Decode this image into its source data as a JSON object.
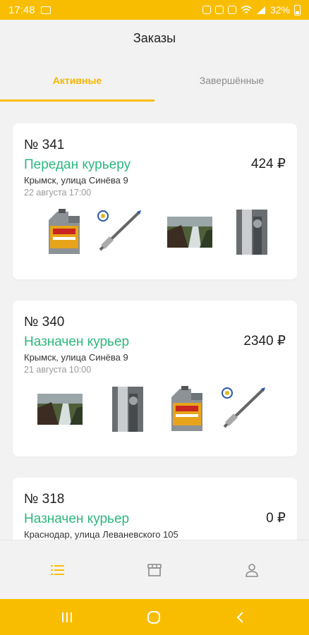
{
  "status_bar": {
    "time": "17:48",
    "battery": "32%",
    "icons": [
      "image-icon",
      "alarm-icon",
      "mute-icon",
      "nfc-icon",
      "wifi-icon",
      "signal-icon",
      "battery-icon"
    ]
  },
  "header": {
    "title": "Заказы"
  },
  "tabs": [
    {
      "label": "Активные",
      "active": true
    },
    {
      "label": "Завершённые",
      "active": false
    }
  ],
  "orders": [
    {
      "number": "№ 341",
      "status": "Передан курьеру",
      "price": "424 ₽",
      "address": "Крымск, улица Синёва 9",
      "date": "22 августа 17:00",
      "items": [
        "motor-oil-can",
        "pen",
        "waterfall-photo",
        "portrait-photo"
      ]
    },
    {
      "number": "№ 340",
      "status": "Назначен курьер",
      "price": "2340 ₽",
      "address": "Крымск, улица Синёва 9",
      "date": "21 августа 10:00",
      "items": [
        "waterfall-photo",
        "portrait-photo",
        "motor-oil-can",
        "pen"
      ]
    },
    {
      "number": "№ 318",
      "status": "Назначен курьер",
      "price": "0 ₽",
      "address": "Краснодар, улица Леваневского 105",
      "date": "",
      "items": []
    }
  ],
  "bottom_nav": [
    {
      "icon": "list-icon",
      "active": true
    },
    {
      "icon": "store-icon",
      "active": false
    },
    {
      "icon": "profile-icon",
      "active": false
    }
  ],
  "system_nav": [
    "recents-icon",
    "home-icon",
    "back-icon"
  ],
  "colors": {
    "accent": "#f9bd00",
    "status_green": "#2eb67d",
    "tab_active_text": "#f5b400"
  }
}
